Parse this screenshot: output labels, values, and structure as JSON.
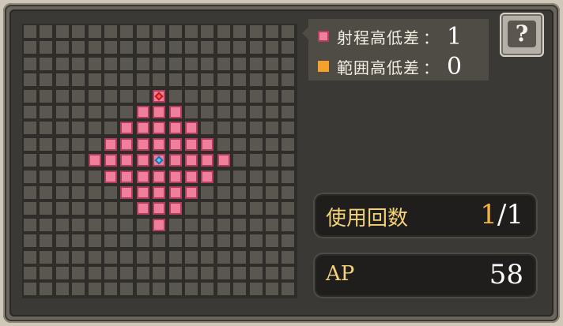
{
  "legend": {
    "range_height_label": "射程高低差",
    "range_height_value": "1",
    "area_height_label": "範囲高低差",
    "area_height_value": "0",
    "colon": "："
  },
  "help": {
    "icon": "?"
  },
  "stats": {
    "uses_label": "使用回数",
    "uses_current": "1",
    "uses_slash": "/",
    "uses_max": "1",
    "ap_label": "AP",
    "ap_value": "58"
  },
  "colors": {
    "range_fill": "#ef7f9b",
    "area_fill": "#f6a12c",
    "self_marker": "#58c8ff",
    "target_marker": "#ff5a5a"
  },
  "grid": {
    "rows": 17,
    "cols": 17,
    "self_cell": [
      8,
      8
    ],
    "target_cell": [
      4,
      8
    ],
    "range_rows": [
      [
        4,
        8,
        8
      ],
      [
        5,
        7,
        9
      ],
      [
        6,
        6,
        10
      ],
      [
        7,
        5,
        11
      ],
      [
        8,
        4,
        12
      ],
      [
        9,
        5,
        11
      ],
      [
        10,
        6,
        10
      ],
      [
        11,
        7,
        9
      ],
      [
        12,
        8,
        8
      ]
    ]
  }
}
